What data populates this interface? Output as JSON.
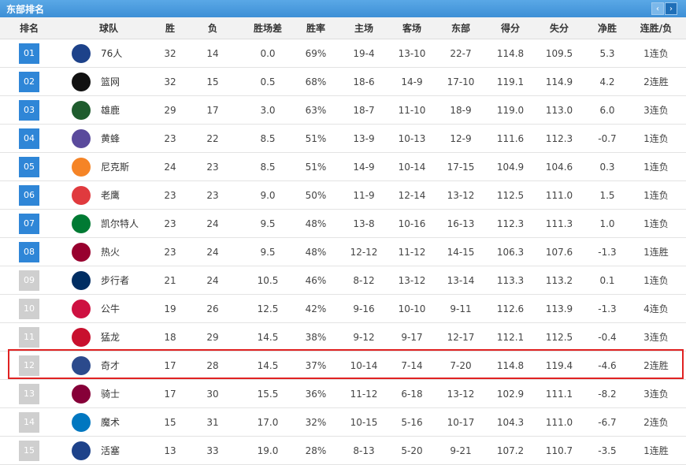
{
  "panel": {
    "title": "东部排名",
    "prev_label": "‹",
    "next_label": "›"
  },
  "columns": [
    "排名",
    "球队",
    "胜",
    "负",
    "胜场差",
    "胜率",
    "主场",
    "客场",
    "东部",
    "得分",
    "失分",
    "净胜",
    "连胜/负"
  ],
  "playoff_cutoff_rank": 8,
  "highlight_rank": "12",
  "rows": [
    {
      "rank": "01",
      "team": "76人",
      "logo": "76ers-logo",
      "w": "32",
      "l": "14",
      "gb": "0.0",
      "pct": "69%",
      "home": "19-4",
      "away": "13-10",
      "east": "22-7",
      "pts": "114.8",
      "opp": "109.5",
      "diff": "5.3",
      "streak": "1连负"
    },
    {
      "rank": "02",
      "team": "篮网",
      "logo": "nets-logo",
      "w": "32",
      "l": "15",
      "gb": "0.5",
      "pct": "68%",
      "home": "18-6",
      "away": "14-9",
      "east": "17-10",
      "pts": "119.1",
      "opp": "114.9",
      "diff": "4.2",
      "streak": "2连胜"
    },
    {
      "rank": "03",
      "team": "雄鹿",
      "logo": "bucks-logo",
      "w": "29",
      "l": "17",
      "gb": "3.0",
      "pct": "63%",
      "home": "18-7",
      "away": "11-10",
      "east": "18-9",
      "pts": "119.0",
      "opp": "113.0",
      "diff": "6.0",
      "streak": "3连负"
    },
    {
      "rank": "04",
      "team": "黄蜂",
      "logo": "hornets-logo",
      "w": "23",
      "l": "22",
      "gb": "8.5",
      "pct": "51%",
      "home": "13-9",
      "away": "10-13",
      "east": "12-9",
      "pts": "111.6",
      "opp": "112.3",
      "diff": "-0.7",
      "streak": "1连负"
    },
    {
      "rank": "05",
      "team": "尼克斯",
      "logo": "knicks-logo",
      "w": "24",
      "l": "23",
      "gb": "8.5",
      "pct": "51%",
      "home": "14-9",
      "away": "10-14",
      "east": "17-15",
      "pts": "104.9",
      "opp": "104.6",
      "diff": "0.3",
      "streak": "1连负"
    },
    {
      "rank": "06",
      "team": "老鹰",
      "logo": "hawks-logo",
      "w": "23",
      "l": "23",
      "gb": "9.0",
      "pct": "50%",
      "home": "11-9",
      "away": "12-14",
      "east": "13-12",
      "pts": "112.5",
      "opp": "111.0",
      "diff": "1.5",
      "streak": "1连负"
    },
    {
      "rank": "07",
      "team": "凯尔特人",
      "logo": "celtics-logo",
      "w": "23",
      "l": "24",
      "gb": "9.5",
      "pct": "48%",
      "home": "13-8",
      "away": "10-16",
      "east": "16-13",
      "pts": "112.3",
      "opp": "111.3",
      "diff": "1.0",
      "streak": "1连负"
    },
    {
      "rank": "08",
      "team": "热火",
      "logo": "heat-logo",
      "w": "23",
      "l": "24",
      "gb": "9.5",
      "pct": "48%",
      "home": "12-12",
      "away": "11-12",
      "east": "14-15",
      "pts": "106.3",
      "opp": "107.6",
      "diff": "-1.3",
      "streak": "1连胜"
    },
    {
      "rank": "09",
      "team": "步行者",
      "logo": "pacers-logo",
      "w": "21",
      "l": "24",
      "gb": "10.5",
      "pct": "46%",
      "home": "8-12",
      "away": "13-12",
      "east": "13-14",
      "pts": "113.3",
      "opp": "113.2",
      "diff": "0.1",
      "streak": "1连负"
    },
    {
      "rank": "10",
      "team": "公牛",
      "logo": "bulls-logo",
      "w": "19",
      "l": "26",
      "gb": "12.5",
      "pct": "42%",
      "home": "9-16",
      "away": "10-10",
      "east": "9-11",
      "pts": "112.6",
      "opp": "113.9",
      "diff": "-1.3",
      "streak": "4连负"
    },
    {
      "rank": "11",
      "team": "猛龙",
      "logo": "raptors-logo",
      "w": "18",
      "l": "29",
      "gb": "14.5",
      "pct": "38%",
      "home": "9-12",
      "away": "9-17",
      "east": "12-17",
      "pts": "112.1",
      "opp": "112.5",
      "diff": "-0.4",
      "streak": "3连负"
    },
    {
      "rank": "12",
      "team": "奇才",
      "logo": "wizards-logo",
      "w": "17",
      "l": "28",
      "gb": "14.5",
      "pct": "37%",
      "home": "10-14",
      "away": "7-14",
      "east": "7-20",
      "pts": "114.8",
      "opp": "119.4",
      "diff": "-4.6",
      "streak": "2连胜"
    },
    {
      "rank": "13",
      "team": "骑士",
      "logo": "cavaliers-logo",
      "w": "17",
      "l": "30",
      "gb": "15.5",
      "pct": "36%",
      "home": "11-12",
      "away": "6-18",
      "east": "13-12",
      "pts": "102.9",
      "opp": "111.1",
      "diff": "-8.2",
      "streak": "3连负"
    },
    {
      "rank": "14",
      "team": "魔术",
      "logo": "magic-logo",
      "w": "15",
      "l": "31",
      "gb": "17.0",
      "pct": "32%",
      "home": "10-15",
      "away": "5-16",
      "east": "10-17",
      "pts": "104.3",
      "opp": "111.0",
      "diff": "-6.7",
      "streak": "2连负"
    },
    {
      "rank": "15",
      "team": "活塞",
      "logo": "pistons-logo",
      "w": "13",
      "l": "33",
      "gb": "19.0",
      "pct": "28%",
      "home": "8-13",
      "away": "5-20",
      "east": "9-21",
      "pts": "107.2",
      "opp": "110.7",
      "diff": "-3.5",
      "streak": "1连胜"
    }
  ],
  "logo_colors": {
    "76ers-logo": "#1d428a",
    "nets-logo": "#111111",
    "bucks-logo": "#1f5c2e",
    "hornets-logo": "#5a4a9c",
    "knicks-logo": "#f58426",
    "hawks-logo": "#e03a3e",
    "celtics-logo": "#007a33",
    "heat-logo": "#98002e",
    "pacers-logo": "#002d62",
    "bulls-logo": "#ce1141",
    "raptors-logo": "#c8102e",
    "wizards-logo": "#2b4a8c",
    "cavaliers-logo": "#860038",
    "magic-logo": "#0077c0",
    "pistons-logo": "#1d428a"
  }
}
